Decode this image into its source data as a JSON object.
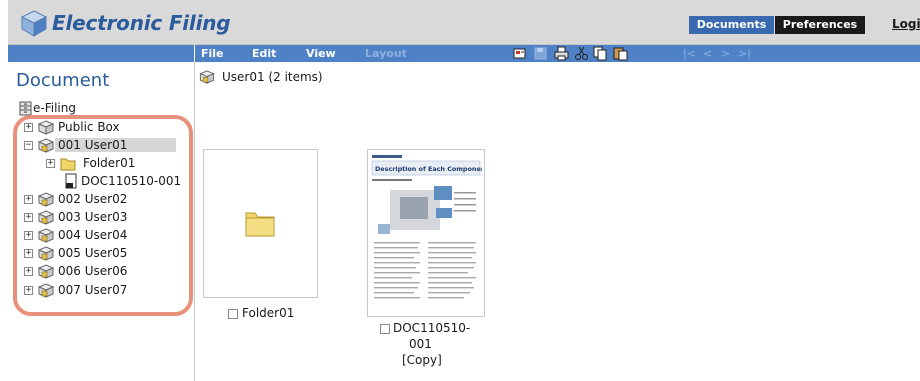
{
  "header": {
    "app_title": "Electronic Filing",
    "tabs": [
      {
        "label": "Documents"
      },
      {
        "label": "Preferences"
      }
    ],
    "login_label": "Logi"
  },
  "toolbar": {
    "menus": [
      {
        "label": "File"
      },
      {
        "label": "Edit"
      },
      {
        "label": "View"
      },
      {
        "label": "Layout"
      }
    ],
    "nav_arrows": [
      "|<",
      "<",
      ">",
      ">|"
    ]
  },
  "sidebar": {
    "title": "Document",
    "root": {
      "label": "e-Filing"
    },
    "items": [
      {
        "label": "Public Box"
      },
      {
        "label": "001 User01"
      },
      {
        "label": "Folder01"
      },
      {
        "label": "DOC110510-001"
      },
      {
        "label": "002 User02"
      },
      {
        "label": "003 User03"
      },
      {
        "label": "004 User04"
      },
      {
        "label": "005 User05"
      },
      {
        "label": "006 User06"
      },
      {
        "label": "007 User07"
      }
    ]
  },
  "content": {
    "breadcrumb": "User01  (2 items)",
    "items": [
      {
        "caption": "Folder01"
      },
      {
        "caption_lines": [
          "DOC110510-",
          "001",
          "[Copy]"
        ]
      }
    ],
    "doc_preview": {
      "heading": "Description of Each Component"
    }
  },
  "colors": {
    "header_bg": "#d9d9d9",
    "toolbar_bg": "#4f81c7",
    "title_blue": "#2a5b9c",
    "documents_tab": "#3a6ab0",
    "preferences_tab": "#1a1a1a",
    "highlight": "#e8917a",
    "folder": "#f1d56b"
  }
}
